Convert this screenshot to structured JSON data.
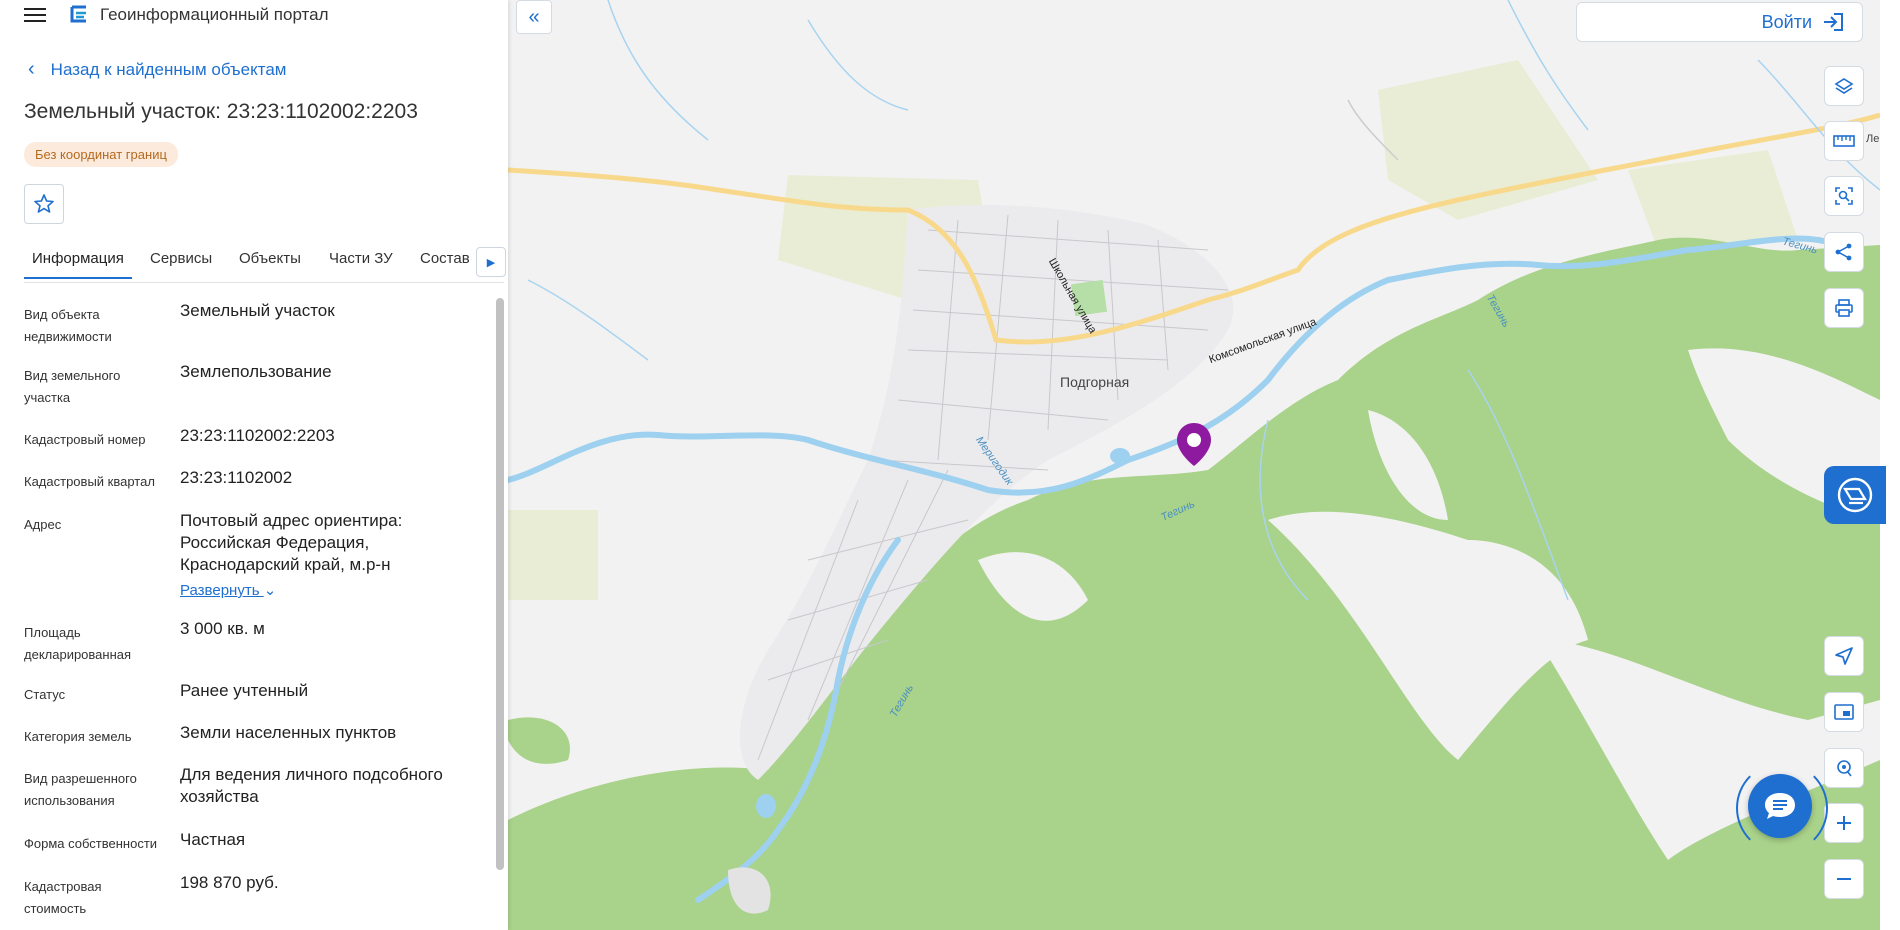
{
  "header": {
    "app_title": "Геоинформационный портал"
  },
  "nav": {
    "back_label": "Назад к найденным объектам"
  },
  "object": {
    "title": "Земельный участок: 23:23:1102002:2203",
    "badge": "Без координат границ"
  },
  "tabs": [
    {
      "label": "Информация",
      "active": true
    },
    {
      "label": "Сервисы",
      "active": false
    },
    {
      "label": "Объекты",
      "active": false
    },
    {
      "label": "Части ЗУ",
      "active": false
    },
    {
      "label": "Состав",
      "active": false
    }
  ],
  "properties": [
    {
      "label": "Вид объекта недвижимости",
      "value": "Земельный участок"
    },
    {
      "label": "Вид земельного участка",
      "value": "Землепользование"
    },
    {
      "label": "Кадастровый номер",
      "value": "23:23:1102002:2203"
    },
    {
      "label": "Кадастровый квартал",
      "value": "23:23:1102002"
    },
    {
      "label": "Адрес",
      "value": "Почтовый адрес ориентира: Российская Федерация, Краснодарский край, м.р-н",
      "expand_label": "Развернуть"
    },
    {
      "label": "Площадь декларированная",
      "value": "3 000 кв. м"
    },
    {
      "label": "Статус",
      "value": "Ранее учтенный"
    },
    {
      "label": "Категория земель",
      "value": "Земли населенных пунктов"
    },
    {
      "label": "Вид разрешенного использования",
      "value": "Для ведения личного подсобного хозяйства"
    },
    {
      "label": "Форма собственности",
      "value": "Частная"
    },
    {
      "label": "Кадастровая стоимость",
      "value": "198 870 руб."
    }
  ],
  "map": {
    "login_label": "Войти",
    "labels": {
      "settlement": "Подгорная",
      "street_1": "Школьная улица",
      "street_2": "Комсомольская улица",
      "river_1": "Тегинь",
      "river_2": "Тегинь",
      "river_3": "Тегинь",
      "river_4": "Тегинь",
      "river_5": "Меригодик",
      "edge_label": "Ле"
    },
    "marker_color": "#8e1aa0",
    "accent_color": "#1f6fd0"
  }
}
